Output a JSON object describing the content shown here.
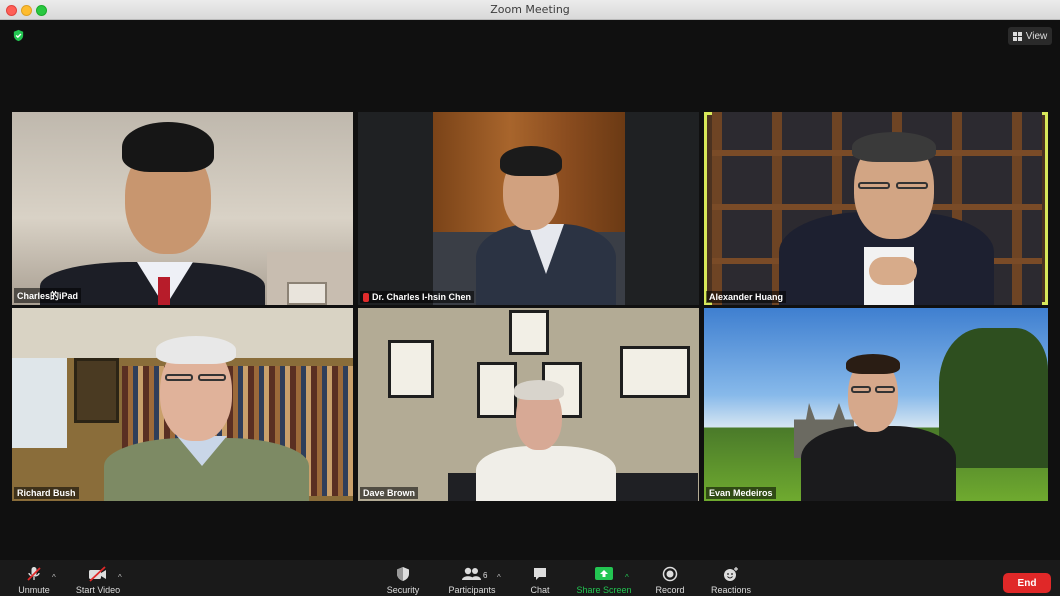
{
  "window": {
    "title": "Zoom Meeting"
  },
  "top": {
    "view_label": "View"
  },
  "participants": [
    {
      "name": "Charles的iPad"
    },
    {
      "name": "Dr. Charles I-hsin Chen"
    },
    {
      "name": "Alexander Huang"
    },
    {
      "name": "Richard Bush"
    },
    {
      "name": "Dave Brown"
    },
    {
      "name": "Evan Medeiros"
    }
  ],
  "toolbar": {
    "unmute": "Unmute",
    "start_video": "Start Video",
    "security": "Security",
    "participants": "Participants",
    "participants_count": "6",
    "chat": "Chat",
    "share_screen": "Share Screen",
    "record": "Record",
    "reactions": "Reactions",
    "end": "End"
  },
  "colors": {
    "active_speaker": "#d8e85a",
    "end_button": "#e02828",
    "share_green": "#23c552"
  }
}
